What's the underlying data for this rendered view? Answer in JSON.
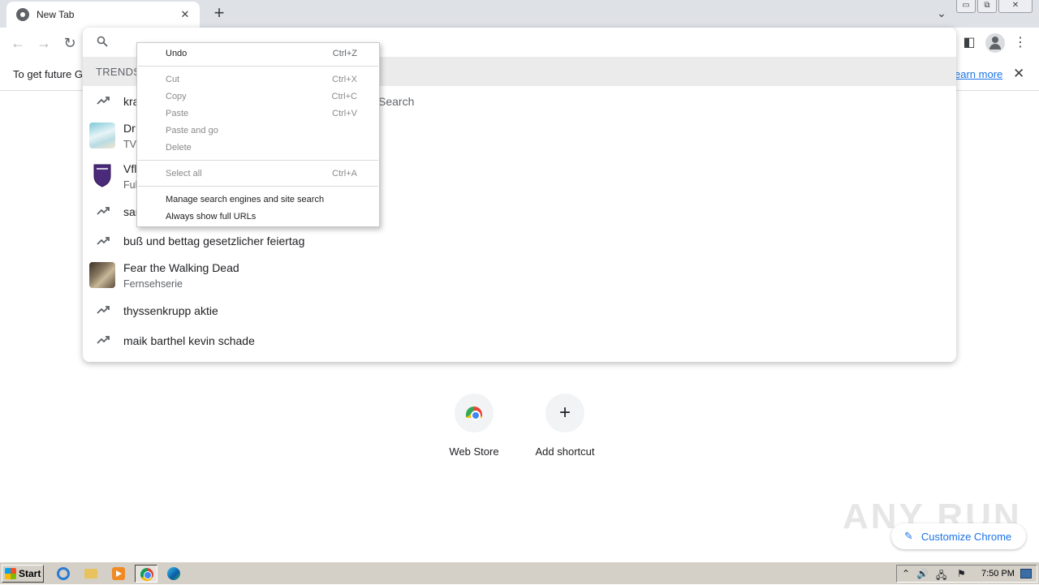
{
  "browser": {
    "tab": {
      "title": "New Tab",
      "close": "✕"
    },
    "new_tab": "+",
    "tab_search": "⌄",
    "window_buttons": {
      "minimize": "▭",
      "restore": "⧉",
      "close": "✕"
    }
  },
  "toolbar": {
    "back": "←",
    "forward": "→",
    "reload": "↻",
    "side_panel": "◧",
    "menu": "⋮"
  },
  "infobar": {
    "message": "To get future G",
    "link": "earn more",
    "close": "✕"
  },
  "omnibox": {
    "trends_title": "TRENDS",
    "hint": "Search",
    "suggestions": [
      {
        "type": "trend",
        "text": "kra"
      },
      {
        "type": "entity",
        "text": "Dr",
        "sub": "TV",
        "thumb": "thumb-a"
      },
      {
        "type": "entity",
        "text": "Vfl",
        "sub": "Ful",
        "thumb": "thumb-b"
      },
      {
        "type": "trend",
        "text": "sar"
      },
      {
        "type": "trend",
        "text": "buß und bettag gesetzlicher feiertag"
      },
      {
        "type": "entity",
        "text": "Fear the Walking Dead",
        "sub": "Fernsehserie",
        "thumb": "thumb-c"
      },
      {
        "type": "trend",
        "text": "thyssenkrupp aktie"
      },
      {
        "type": "trend",
        "text": "maik barthel kevin schade"
      }
    ]
  },
  "context_menu": {
    "undo": {
      "label": "Undo",
      "key": "Ctrl+Z"
    },
    "cut": {
      "label": "Cut",
      "key": "Ctrl+X"
    },
    "copy": {
      "label": "Copy",
      "key": "Ctrl+C"
    },
    "paste": {
      "label": "Paste",
      "key": "Ctrl+V"
    },
    "paste_go": {
      "label": "Paste and go"
    },
    "delete": {
      "label": "Delete"
    },
    "select_all": {
      "label": "Select all",
      "key": "Ctrl+A"
    },
    "manage": {
      "label": "Manage search engines and site search"
    },
    "full_urls": {
      "label": "Always show full URLs"
    }
  },
  "ntp": {
    "shortcuts": [
      {
        "label": "Web Store"
      },
      {
        "label": "Add shortcut",
        "icon": "+"
      }
    ],
    "customize": {
      "label": "Customize Chrome",
      "icon": "✎"
    },
    "watermark": "ANY RUN"
  },
  "taskbar": {
    "start": "Start",
    "clock": "7:50 PM",
    "tray": {
      "arrow": "⌃",
      "volume": "🔊",
      "network": "🖧",
      "flag": "⚑"
    }
  },
  "colors": {
    "accent": "#1a73e8",
    "tabstrip": "#dee1e6",
    "trends_band": "#ebebeb",
    "taskbar": "#d4d0c8"
  }
}
